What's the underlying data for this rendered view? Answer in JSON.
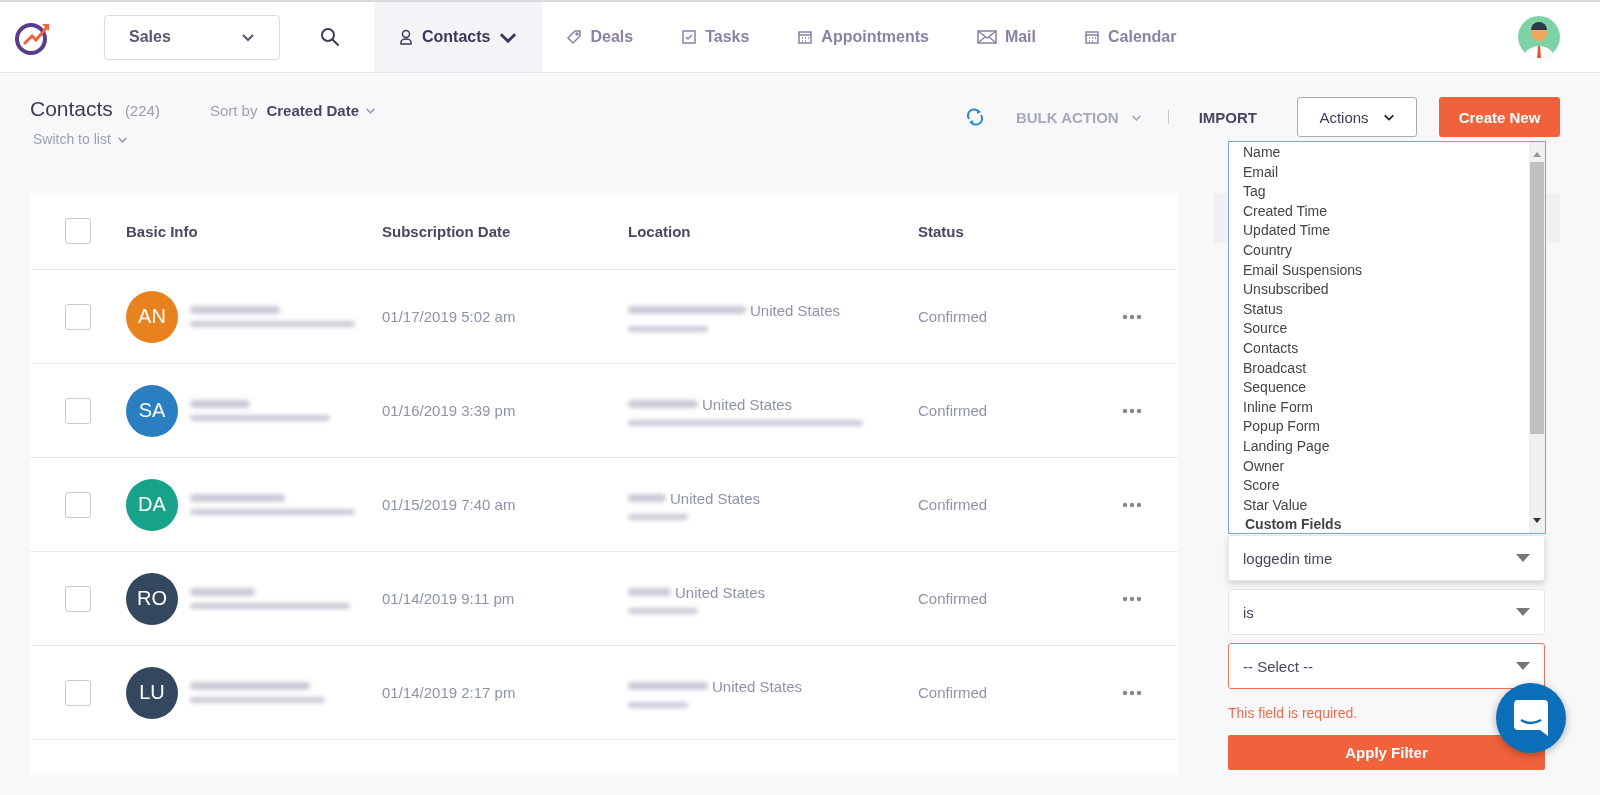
{
  "nav": {
    "workspace": "Sales",
    "tabs": [
      {
        "label": "Contacts",
        "kind": "person",
        "selected": true,
        "dropdown": true
      },
      {
        "label": "Deals",
        "kind": "tag",
        "selected": false
      },
      {
        "label": "Tasks",
        "kind": "task",
        "selected": false
      },
      {
        "label": "Appointments",
        "kind": "calendar",
        "selected": false
      },
      {
        "label": "Mail",
        "kind": "mail",
        "selected": false
      },
      {
        "label": "Calendar",
        "kind": "calendar",
        "selected": false
      }
    ]
  },
  "page": {
    "title": "Contacts",
    "count": "(224)",
    "sort_label": "Sort by",
    "sort_value": "Created Date",
    "view_switch": {
      "label": "Switch to list",
      "expanded": false
    }
  },
  "toolbar": {
    "bulk_action": "BULK ACTION",
    "import": "IMPORT",
    "actions": "Actions",
    "create": "Create New"
  },
  "table": {
    "all_checked": false,
    "columns": [
      "Basic Info",
      "Subscription Date",
      "Location",
      "Status"
    ],
    "rows": [
      {
        "initials": "AN",
        "color": "#e8821f",
        "date": "01/17/2019 5:02 am",
        "location": "United States",
        "status": "Confirmed",
        "checked": false
      },
      {
        "initials": "SA",
        "color": "#2a7fc1",
        "date": "01/16/2019 3:39 pm",
        "location": "United States",
        "status": "Confirmed",
        "checked": false
      },
      {
        "initials": "DA",
        "color": "#17a389",
        "date": "01/15/2019 7:40 am",
        "location": "United States",
        "status": "Confirmed",
        "checked": false
      },
      {
        "initials": "RO",
        "color": "#33475f",
        "date": "01/14/2019 9:11 pm",
        "location": "United States",
        "status": "Confirmed",
        "checked": false
      },
      {
        "initials": "LU",
        "color": "#33475f",
        "date": "01/14/2019 2:17 pm",
        "location": "United States",
        "status": "Confirmed",
        "checked": false
      }
    ]
  },
  "filter": {
    "options": [
      {
        "label": "Name",
        "kind": "option"
      },
      {
        "label": "Email",
        "kind": "option"
      },
      {
        "label": "Tag",
        "kind": "option"
      },
      {
        "label": "Created Time",
        "kind": "option"
      },
      {
        "label": "Updated Time",
        "kind": "option"
      },
      {
        "label": "Country",
        "kind": "option"
      },
      {
        "label": "Email Suspensions",
        "kind": "option"
      },
      {
        "label": "Unsubscribed",
        "kind": "option"
      },
      {
        "label": "Status",
        "kind": "option"
      },
      {
        "label": "Source",
        "kind": "option"
      },
      {
        "label": "Contacts",
        "kind": "option"
      },
      {
        "label": "Broadcast",
        "kind": "option"
      },
      {
        "label": "Sequence",
        "kind": "option"
      },
      {
        "label": "Inline Form",
        "kind": "option"
      },
      {
        "label": "Popup Form",
        "kind": "option"
      },
      {
        "label": "Landing Page",
        "kind": "option"
      },
      {
        "label": "Owner",
        "kind": "option"
      },
      {
        "label": "Score",
        "kind": "option"
      },
      {
        "label": "Star Value",
        "kind": "option"
      },
      {
        "label": "Custom Fields",
        "kind": "group"
      }
    ],
    "selects": [
      {
        "value": "loggedin time",
        "error": false
      },
      {
        "value": "is",
        "error": false
      },
      {
        "value": "-- Select --",
        "error": true
      }
    ],
    "error_message": "This field is required.",
    "apply": "Apply Filter"
  }
}
